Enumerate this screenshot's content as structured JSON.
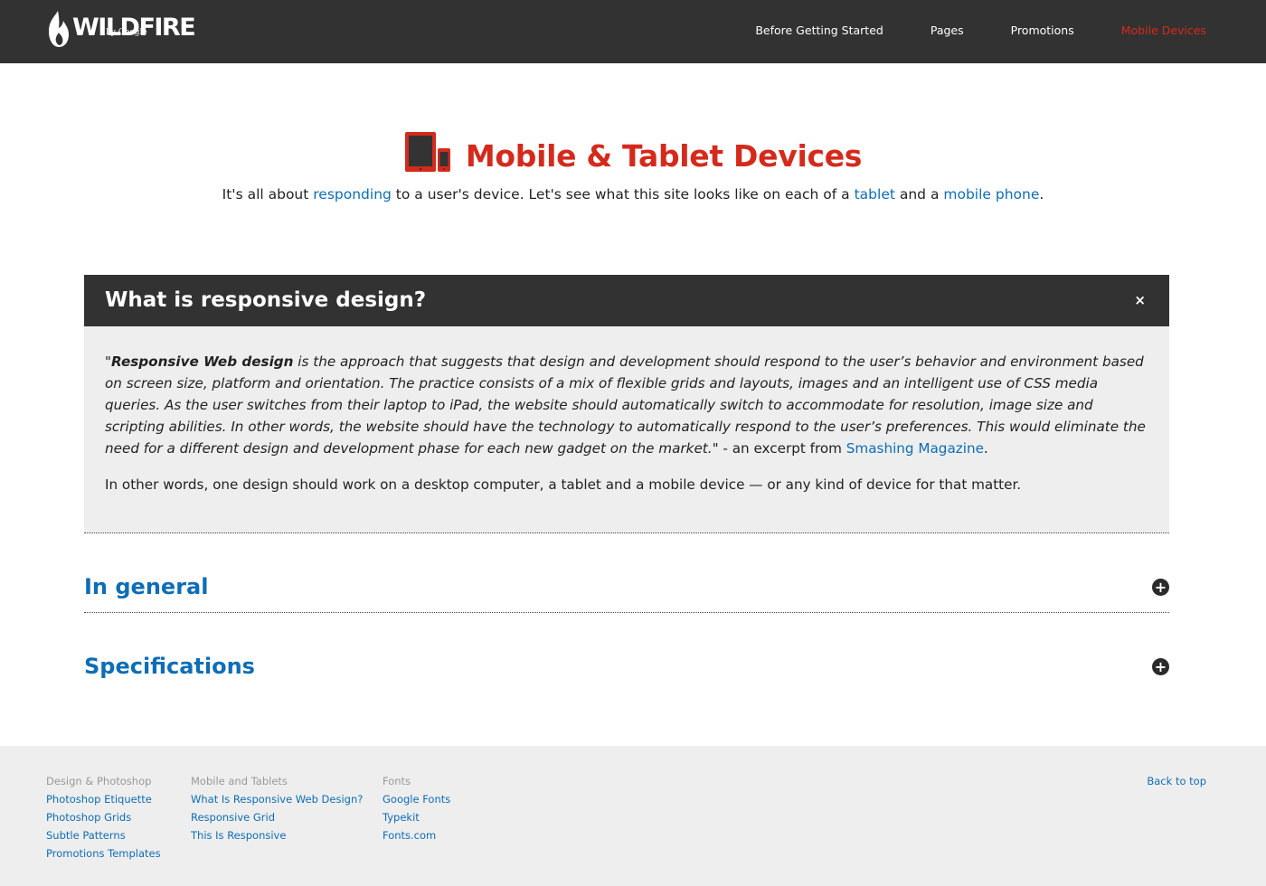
{
  "header": {
    "logo_text": "WILDFIRE",
    "logo_sub": "by Google",
    "nav": [
      {
        "label": "Before Getting Started"
      },
      {
        "label": "Pages"
      },
      {
        "label": "Promotions"
      },
      {
        "label": "Mobile Devices",
        "active": true
      }
    ]
  },
  "hero": {
    "title": "Mobile & Tablet Devices",
    "subtitle_parts": {
      "p1": "It's all about ",
      "link1": "responding",
      "p2": " to a user's device. Let's see what this site looks like on each of a ",
      "link2": "tablet",
      "p3": " and a ",
      "link3": "mobile phone",
      "p4": "."
    }
  },
  "panel": {
    "title": "What is responsive design?",
    "close_label": "×",
    "quote_open": "\"",
    "quote_bold": "Responsive Web design",
    "quote_text": " is the approach that suggests that design and development should respond to the user’s behavior and environment based on screen size, platform and orientation. The practice consists of a mix of flexible grids and layouts, images and an intelligent use of CSS media queries. As the user switches from their laptop to iPad, the website should automatically switch to accommodate for resolution, image size and scripting abilities. In other words, the website should have the technology to automatically respond to the user’s preferences. This would eliminate the need for a different design and development phase for each new gadget on the market.",
    "quote_close": "\" - an excerpt from ",
    "source_link": "Smashing Magazine",
    "source_end": ".",
    "paragraph2": "In other words, one design should work on a desktop computer, a tablet and a mobile device — or any kind of device for that matter."
  },
  "accordions": [
    {
      "title": "In general",
      "toggle": "+"
    },
    {
      "title": "Specifications",
      "toggle": "+"
    }
  ],
  "footer": {
    "columns": [
      {
        "heading": "Design & Photoshop",
        "links": [
          "Photoshop Etiquette",
          "Photoshop Grids",
          "Subtle Patterns",
          "Promotions Templates"
        ]
      },
      {
        "heading": "Mobile and Tablets",
        "links": [
          "What Is Responsive Web Design?",
          "Responsive Grid",
          "This Is Responsive"
        ]
      },
      {
        "heading": "Fonts",
        "links": [
          "Google Fonts",
          "Typekit",
          "Fonts.com"
        ]
      }
    ],
    "back_to_top": "Back to top"
  },
  "colors": {
    "header_bg": "#323232",
    "accent_red": "#d42a1c",
    "link_blue": "#0e6db5",
    "panel_bg": "#eeeeee",
    "footer_bg": "#eeeeee"
  },
  "icons": [
    "wildfire-flame-logo-icon",
    "devices-icon",
    "close-icon",
    "plus-circle-icon"
  ]
}
